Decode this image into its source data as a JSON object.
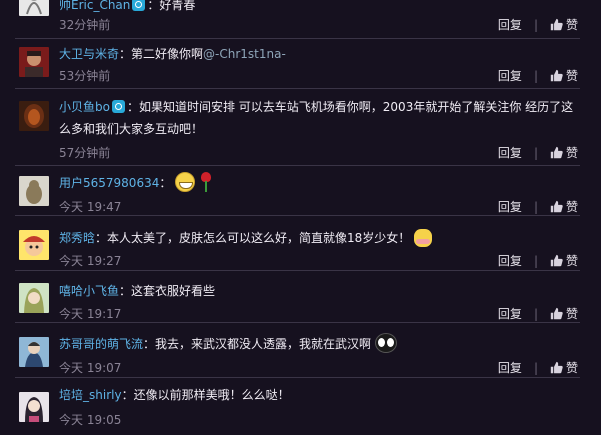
{
  "actions": {
    "reply_label": "回复",
    "like_label": "赞"
  },
  "comments": [
    {
      "user": "帅Eric_Chan",
      "text": "：好青春",
      "time": "32分钟前",
      "camera": true
    },
    {
      "user": "大卫与米奇",
      "text": "：第二好像你啊",
      "mention": "@-Chr1st1na-",
      "time": "53分钟前"
    },
    {
      "user": "小贝鱼bo",
      "text": "：如果知道时间安排 可以去车站飞机场看你啊，2003年就开始了解关注你 经历了这么多和我们大家多互动吧！",
      "time": "57分钟前",
      "camera": true
    },
    {
      "user": "用户5657980634",
      "text": "：",
      "time": "今天 19:47",
      "emoji": [
        "grin-emoji",
        "rose-emoji"
      ]
    },
    {
      "user": "郑秀晗",
      "text": "：本人太美了，皮肤怎么可以这么好，简直就像18岁少女！",
      "time": "今天 19:27",
      "emoji": [
        "shy-emoji"
      ]
    },
    {
      "user": "嘻哈小飞鱼",
      "text": "：这套衣服好看些",
      "time": "今天 19:17"
    },
    {
      "user": "苏哥哥的萌飞流",
      "text": "：我去，来武汉都没人透露，我就在武汉啊",
      "time": "今天 19:07",
      "emoji": [
        "eyes-emoji"
      ]
    },
    {
      "user": "培培_shirly",
      "text": "：还像以前那样美哦！么么哒！",
      "time": "今天 19:05"
    }
  ],
  "colors": {
    "background": "#16111f",
    "username": "#5fb3e6",
    "time": "#8a8395",
    "divider": "#3a3446"
  }
}
